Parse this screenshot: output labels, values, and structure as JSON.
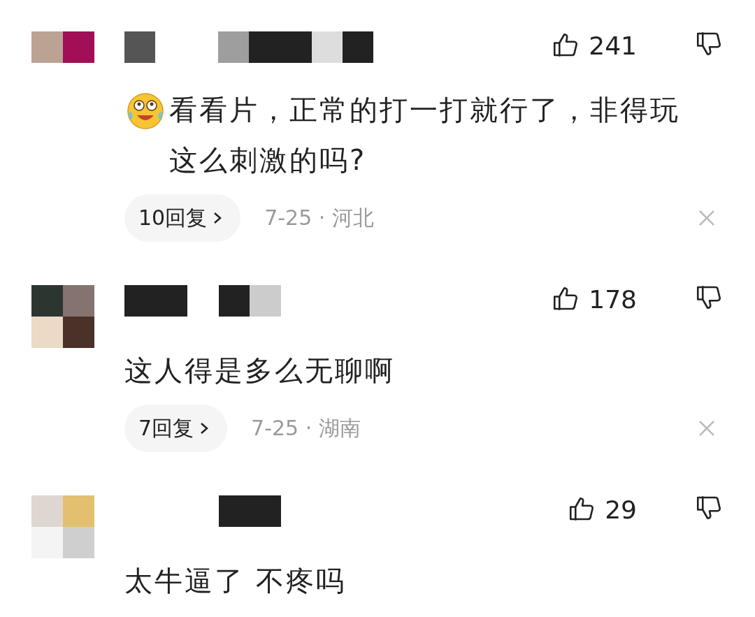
{
  "comments": [
    {
      "likes": "241",
      "leading_emoji": true,
      "text": "看看片，正常的打一打就行了，非得玩这么刺激的吗?",
      "replies": "10回复",
      "meta": "7-25 · 河北"
    },
    {
      "likes": "178",
      "leading_emoji": false,
      "text": "这人得是多么无聊啊",
      "replies": "7回复",
      "meta": "7-25 · 湖南"
    },
    {
      "likes": "29",
      "leading_emoji": false,
      "text": "太牛逼了 不疼吗"
    }
  ]
}
